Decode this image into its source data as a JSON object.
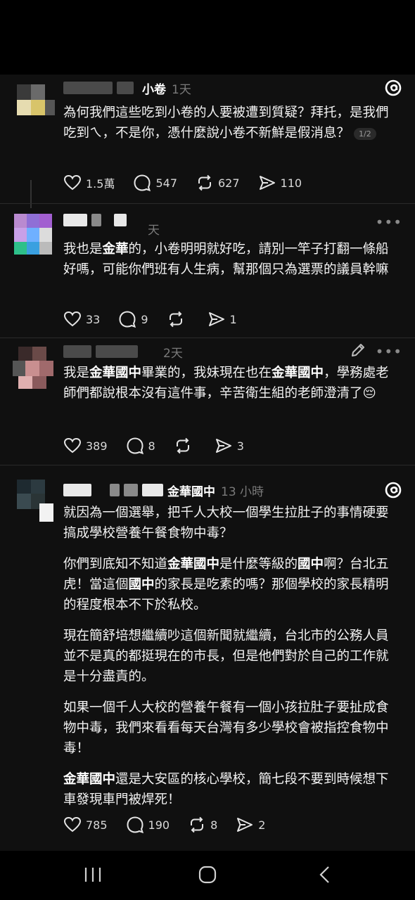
{
  "posts": [
    {
      "topic": "小卷",
      "time": "1天",
      "text_a": "為何我們這些吃到小卷的人要被遭到質疑？拜托，是我們吃到ㄟ，不是你，憑什麼說小卷不新鮮是假消息？",
      "pager": "1/2",
      "likes": "1.5萬",
      "replies": "547",
      "reposts": "627",
      "shares": "110"
    },
    {
      "time": "天",
      "text_a": "我也是",
      "hl_1": "金華",
      "text_b": "的，小卷明明就好吃，請別一竿子打翻一條船好嗎，可能你們班有人生病，幫那個只為選票的議員幹嘛",
      "likes": "33",
      "replies": "9",
      "reposts": "",
      "shares": "1"
    },
    {
      "time": "2天",
      "text_a": "我是",
      "hl_1": "金華國中",
      "text_b": "畢業的，我妹現在也在",
      "hl_2": "金華國中",
      "text_c": "，學務處老師們都說根本沒有這件事，辛苦衛生組的老師澄清了",
      "emoji": "😔",
      "likes": "389",
      "replies": "8",
      "reposts": "",
      "shares": "3"
    },
    {
      "topic": "金華國中",
      "time": "13 小時",
      "p1": "就因為一個選舉，把千人大校一個學生拉肚子的事情硬要搞成學校營養午餐食物中毒？",
      "p2_a": "你們到底知不知道",
      "p2_hl1": "金華國中",
      "p2_b": "是什麼等級的",
      "p2_hl2": "國中",
      "p2_c": "啊？台北五虎！當這個",
      "p2_hl3": "國中",
      "p2_d": "的家長是吃素的嗎？那個學校的家長精明的程度根本不下於私校。",
      "p3": "現在簡舒培想繼續吵這個新聞就繼續，台北市的公務人員並不是真的都挺現在的市長，但是他們對於自己的工作就是十分盡責的。",
      "p4": "如果一個千人大校的營養午餐有一個小孩拉肚子要扯成食物中毒，我們來看看每天台灣有多少學校會被指控食物中毒！",
      "p5_hl": "金華國中",
      "p5_b": "還是大安區的核心學校，簡七段不要到時候想下車發現車門被焊死！",
      "likes": "785",
      "replies": "190",
      "reposts": "8",
      "shares": "2"
    }
  ],
  "colors": {
    "background": "#101010",
    "text": "#f3f3f3",
    "muted": "#7a7a7a"
  }
}
